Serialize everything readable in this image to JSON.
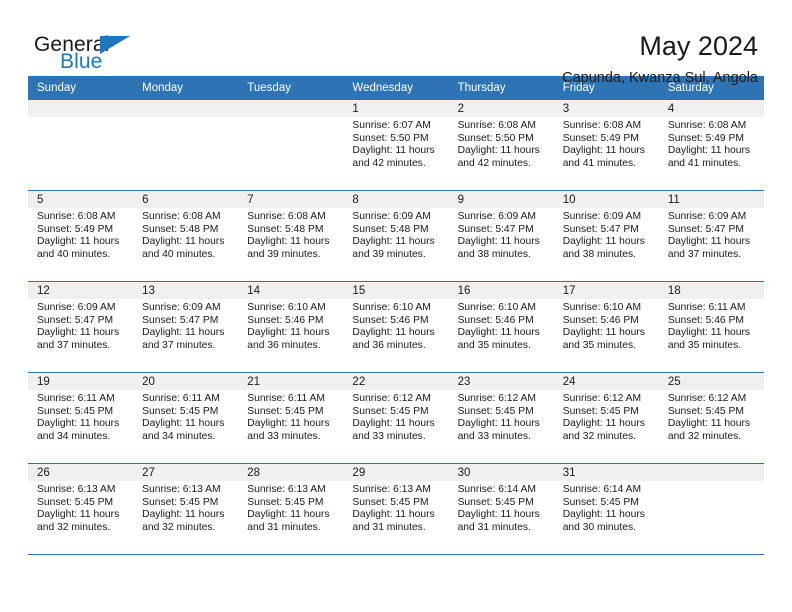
{
  "brand": {
    "line1": "General",
    "line2": "Blue",
    "triangle_color": "#1f76bc"
  },
  "header": {
    "title": "May 2024",
    "subtitle": "Capunda, Kwanza Sul, Angola"
  },
  "theme": {
    "header_blue": "#2e74b5",
    "daynum_band": "#f0f0f0",
    "text": "#1a1a1a"
  },
  "weekday_headers": [
    "Sunday",
    "Monday",
    "Tuesday",
    "Wednesday",
    "Thursday",
    "Friday",
    "Saturday"
  ],
  "weeks": [
    [
      {
        "day": "",
        "sunrise": "",
        "sunset": "",
        "daylight1": "",
        "daylight2": ""
      },
      {
        "day": "",
        "sunrise": "",
        "sunset": "",
        "daylight1": "",
        "daylight2": ""
      },
      {
        "day": "",
        "sunrise": "",
        "sunset": "",
        "daylight1": "",
        "daylight2": ""
      },
      {
        "day": "1",
        "sunrise": "Sunrise: 6:07 AM",
        "sunset": "Sunset: 5:50 PM",
        "daylight1": "Daylight: 11 hours",
        "daylight2": "and 42 minutes."
      },
      {
        "day": "2",
        "sunrise": "Sunrise: 6:08 AM",
        "sunset": "Sunset: 5:50 PM",
        "daylight1": "Daylight: 11 hours",
        "daylight2": "and 42 minutes."
      },
      {
        "day": "3",
        "sunrise": "Sunrise: 6:08 AM",
        "sunset": "Sunset: 5:49 PM",
        "daylight1": "Daylight: 11 hours",
        "daylight2": "and 41 minutes."
      },
      {
        "day": "4",
        "sunrise": "Sunrise: 6:08 AM",
        "sunset": "Sunset: 5:49 PM",
        "daylight1": "Daylight: 11 hours",
        "daylight2": "and 41 minutes."
      }
    ],
    [
      {
        "day": "5",
        "sunrise": "Sunrise: 6:08 AM",
        "sunset": "Sunset: 5:49 PM",
        "daylight1": "Daylight: 11 hours",
        "daylight2": "and 40 minutes."
      },
      {
        "day": "6",
        "sunrise": "Sunrise: 6:08 AM",
        "sunset": "Sunset: 5:48 PM",
        "daylight1": "Daylight: 11 hours",
        "daylight2": "and 40 minutes."
      },
      {
        "day": "7",
        "sunrise": "Sunrise: 6:08 AM",
        "sunset": "Sunset: 5:48 PM",
        "daylight1": "Daylight: 11 hours",
        "daylight2": "and 39 minutes."
      },
      {
        "day": "8",
        "sunrise": "Sunrise: 6:09 AM",
        "sunset": "Sunset: 5:48 PM",
        "daylight1": "Daylight: 11 hours",
        "daylight2": "and 39 minutes."
      },
      {
        "day": "9",
        "sunrise": "Sunrise: 6:09 AM",
        "sunset": "Sunset: 5:47 PM",
        "daylight1": "Daylight: 11 hours",
        "daylight2": "and 38 minutes."
      },
      {
        "day": "10",
        "sunrise": "Sunrise: 6:09 AM",
        "sunset": "Sunset: 5:47 PM",
        "daylight1": "Daylight: 11 hours",
        "daylight2": "and 38 minutes."
      },
      {
        "day": "11",
        "sunrise": "Sunrise: 6:09 AM",
        "sunset": "Sunset: 5:47 PM",
        "daylight1": "Daylight: 11 hours",
        "daylight2": "and 37 minutes."
      }
    ],
    [
      {
        "day": "12",
        "sunrise": "Sunrise: 6:09 AM",
        "sunset": "Sunset: 5:47 PM",
        "daylight1": "Daylight: 11 hours",
        "daylight2": "and 37 minutes."
      },
      {
        "day": "13",
        "sunrise": "Sunrise: 6:09 AM",
        "sunset": "Sunset: 5:47 PM",
        "daylight1": "Daylight: 11 hours",
        "daylight2": "and 37 minutes."
      },
      {
        "day": "14",
        "sunrise": "Sunrise: 6:10 AM",
        "sunset": "Sunset: 5:46 PM",
        "daylight1": "Daylight: 11 hours",
        "daylight2": "and 36 minutes."
      },
      {
        "day": "15",
        "sunrise": "Sunrise: 6:10 AM",
        "sunset": "Sunset: 5:46 PM",
        "daylight1": "Daylight: 11 hours",
        "daylight2": "and 36 minutes."
      },
      {
        "day": "16",
        "sunrise": "Sunrise: 6:10 AM",
        "sunset": "Sunset: 5:46 PM",
        "daylight1": "Daylight: 11 hours",
        "daylight2": "and 35 minutes."
      },
      {
        "day": "17",
        "sunrise": "Sunrise: 6:10 AM",
        "sunset": "Sunset: 5:46 PM",
        "daylight1": "Daylight: 11 hours",
        "daylight2": "and 35 minutes."
      },
      {
        "day": "18",
        "sunrise": "Sunrise: 6:11 AM",
        "sunset": "Sunset: 5:46 PM",
        "daylight1": "Daylight: 11 hours",
        "daylight2": "and 35 minutes."
      }
    ],
    [
      {
        "day": "19",
        "sunrise": "Sunrise: 6:11 AM",
        "sunset": "Sunset: 5:45 PM",
        "daylight1": "Daylight: 11 hours",
        "daylight2": "and 34 minutes."
      },
      {
        "day": "20",
        "sunrise": "Sunrise: 6:11 AM",
        "sunset": "Sunset: 5:45 PM",
        "daylight1": "Daylight: 11 hours",
        "daylight2": "and 34 minutes."
      },
      {
        "day": "21",
        "sunrise": "Sunrise: 6:11 AM",
        "sunset": "Sunset: 5:45 PM",
        "daylight1": "Daylight: 11 hours",
        "daylight2": "and 33 minutes."
      },
      {
        "day": "22",
        "sunrise": "Sunrise: 6:12 AM",
        "sunset": "Sunset: 5:45 PM",
        "daylight1": "Daylight: 11 hours",
        "daylight2": "and 33 minutes."
      },
      {
        "day": "23",
        "sunrise": "Sunrise: 6:12 AM",
        "sunset": "Sunset: 5:45 PM",
        "daylight1": "Daylight: 11 hours",
        "daylight2": "and 33 minutes."
      },
      {
        "day": "24",
        "sunrise": "Sunrise: 6:12 AM",
        "sunset": "Sunset: 5:45 PM",
        "daylight1": "Daylight: 11 hours",
        "daylight2": "and 32 minutes."
      },
      {
        "day": "25",
        "sunrise": "Sunrise: 6:12 AM",
        "sunset": "Sunset: 5:45 PM",
        "daylight1": "Daylight: 11 hours",
        "daylight2": "and 32 minutes."
      }
    ],
    [
      {
        "day": "26",
        "sunrise": "Sunrise: 6:13 AM",
        "sunset": "Sunset: 5:45 PM",
        "daylight1": "Daylight: 11 hours",
        "daylight2": "and 32 minutes."
      },
      {
        "day": "27",
        "sunrise": "Sunrise: 6:13 AM",
        "sunset": "Sunset: 5:45 PM",
        "daylight1": "Daylight: 11 hours",
        "daylight2": "and 32 minutes."
      },
      {
        "day": "28",
        "sunrise": "Sunrise: 6:13 AM",
        "sunset": "Sunset: 5:45 PM",
        "daylight1": "Daylight: 11 hours",
        "daylight2": "and 31 minutes."
      },
      {
        "day": "29",
        "sunrise": "Sunrise: 6:13 AM",
        "sunset": "Sunset: 5:45 PM",
        "daylight1": "Daylight: 11 hours",
        "daylight2": "and 31 minutes."
      },
      {
        "day": "30",
        "sunrise": "Sunrise: 6:14 AM",
        "sunset": "Sunset: 5:45 PM",
        "daylight1": "Daylight: 11 hours",
        "daylight2": "and 31 minutes."
      },
      {
        "day": "31",
        "sunrise": "Sunrise: 6:14 AM",
        "sunset": "Sunset: 5:45 PM",
        "daylight1": "Daylight: 11 hours",
        "daylight2": "and 30 minutes."
      },
      {
        "day": "",
        "sunrise": "",
        "sunset": "",
        "daylight1": "",
        "daylight2": ""
      }
    ]
  ]
}
